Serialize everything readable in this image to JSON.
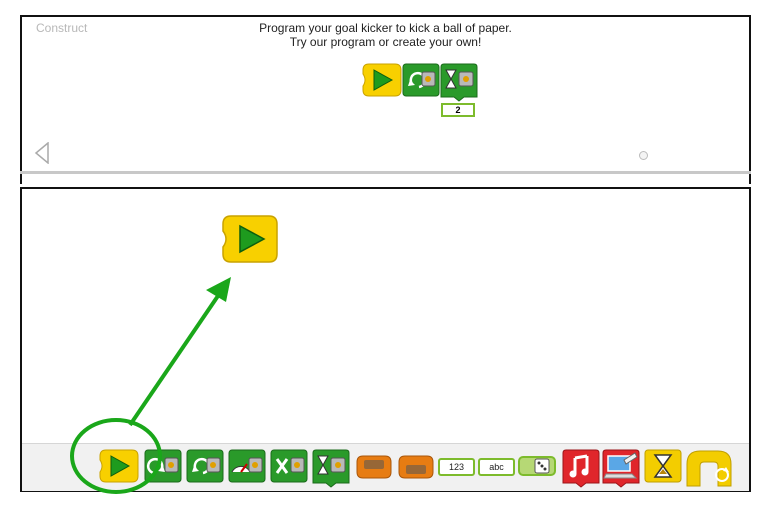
{
  "section_label": "Construct",
  "instructions": {
    "line1": "Program your goal kicker to kick a ball of paper.",
    "line2": "Try our program or create your own!"
  },
  "example_program": {
    "blocks": [
      "start-block",
      "motor-turn-ccw-block",
      "wait-for-block"
    ],
    "wait_value": "2"
  },
  "palette": {
    "blocks": [
      "start-block",
      "motor-turn-cw-block",
      "motor-turn-ccw-block",
      "motor-power-block",
      "motor-off-block",
      "wait-for-block",
      "send-message-block",
      "receive-message-block",
      "number-input-block",
      "text-input-block",
      "random-block",
      "sound-block",
      "display-block",
      "wait-block",
      "repeat-block"
    ],
    "number_label": "123",
    "text_label": "abc"
  },
  "colors": {
    "start_yellow": "#f8d000",
    "action_green": "#2a9a2a",
    "input_green": "#7dbb2c",
    "message_orange": "#e77c12",
    "sound_red": "#e0262b",
    "flow_yellow": "#f3cd00",
    "highlight": "#1aa71a"
  }
}
